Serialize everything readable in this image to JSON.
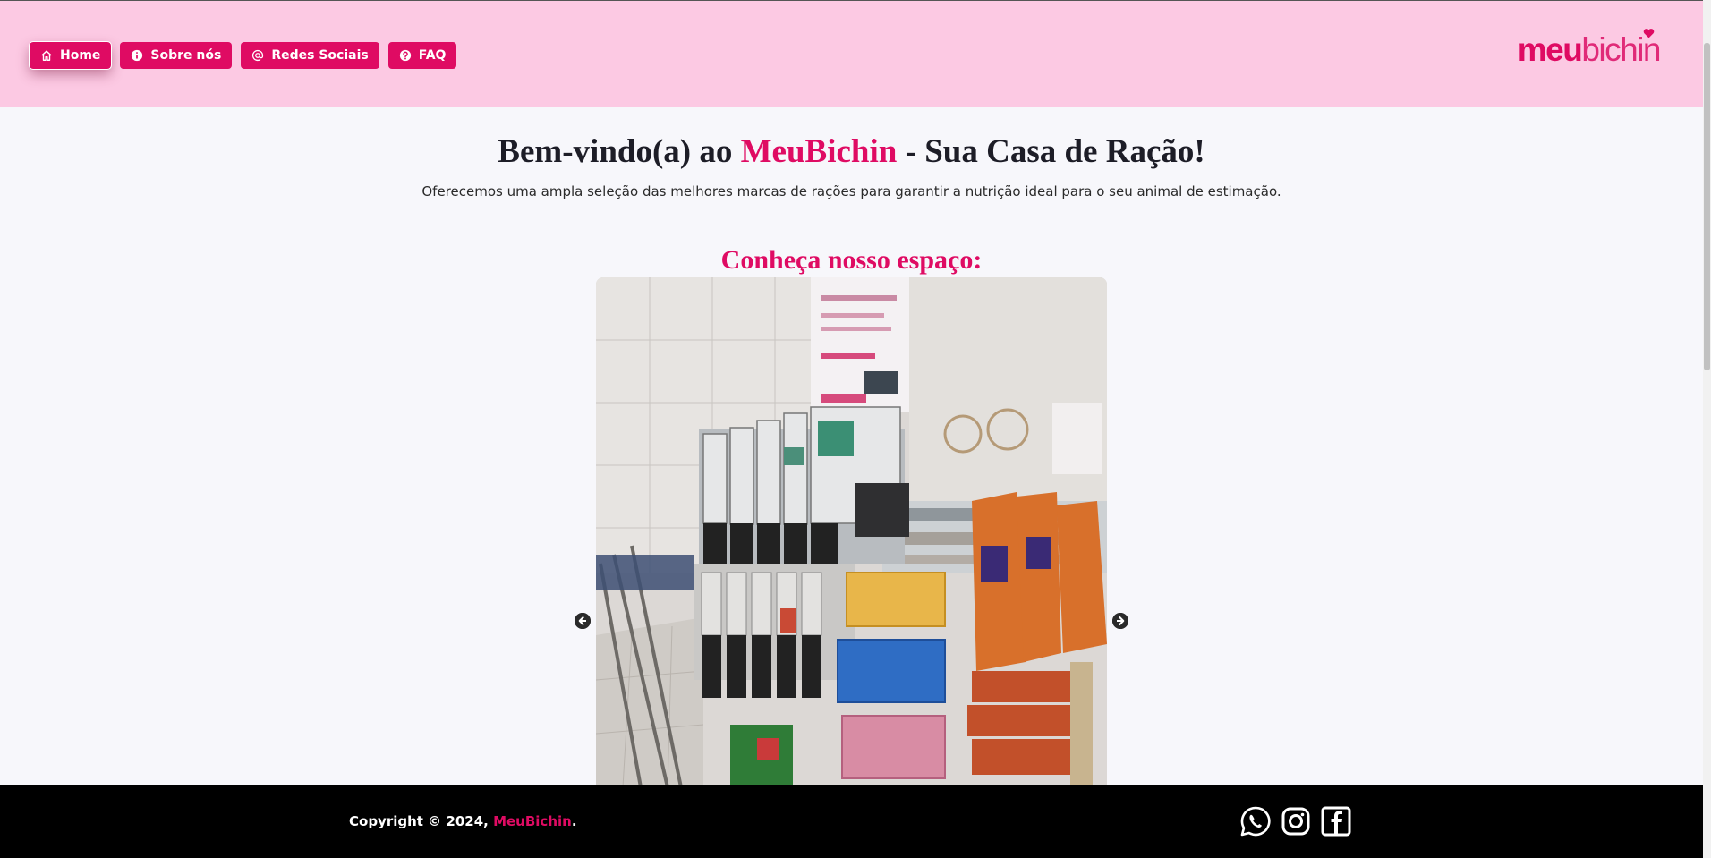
{
  "nav": {
    "items": [
      {
        "label": "Home",
        "icon": "home-icon"
      },
      {
        "label": "Sobre nós",
        "icon": "info-icon"
      },
      {
        "label": "Redes Sociais",
        "icon": "at-icon"
      },
      {
        "label": "FAQ",
        "icon": "question-icon"
      }
    ],
    "active_index": 0
  },
  "logo": {
    "part1": "meu",
    "part2": "bichin"
  },
  "hero": {
    "title_before": "Bem-vindo(a) ao ",
    "title_brand": "MeuBichin",
    "title_after": " - Sua Casa de Ração!",
    "subtitle": "Oferecemos uma ampla seleção das melhores marcas de rações para garantir a nutrição ideal para o seu animal de estimação."
  },
  "gallery": {
    "title": "Conheça nosso espaço:",
    "image": "store-interior-photo",
    "prev_icon": "arrow-left-icon",
    "next_icon": "arrow-right-icon"
  },
  "footer": {
    "copyright_prefix": "Copyright © 2024, ",
    "brand": "MeuBichin",
    "suffix": ".",
    "social": [
      "whatsapp-icon",
      "instagram-icon",
      "facebook-icon"
    ]
  },
  "colors": {
    "brand": "#df0b63",
    "header_bg": "#fcc9e3",
    "page_bg": "#f7f7fb",
    "footer_bg": "#000000"
  }
}
